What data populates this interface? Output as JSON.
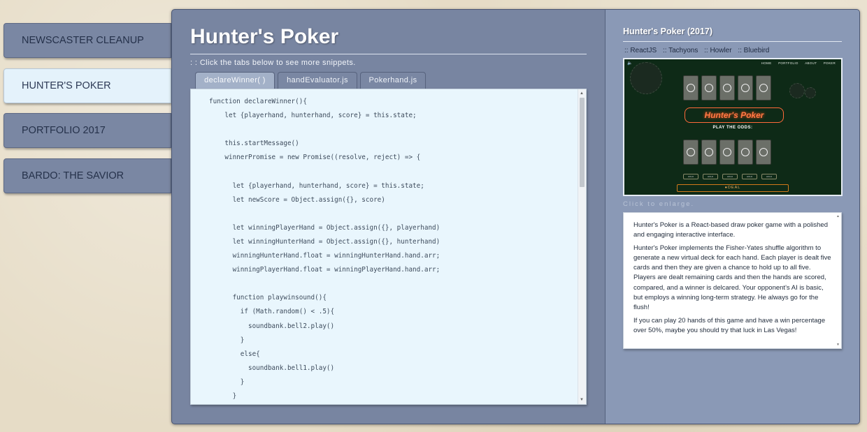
{
  "nav": {
    "items": [
      {
        "label": "NEWSCASTER CLEANUP",
        "active": false
      },
      {
        "label": "HUNTER'S POKER",
        "active": true
      },
      {
        "label": "PORTFOLIO 2017",
        "active": false
      },
      {
        "label": "BARDO: THE SAVIOR",
        "active": false
      }
    ]
  },
  "main": {
    "title": "Hunter's Poker",
    "hint": ": : Click the tabs below to see more snippets.",
    "tabs": [
      {
        "label": "declareWinner( )",
        "active": true
      },
      {
        "label": "handEvaluator.js",
        "active": false
      },
      {
        "label": "Pokerhand.js",
        "active": false
      }
    ],
    "code_lines": [
      "function declareWinner(){",
      "    let {playerhand, hunterhand, score} = this.state;",
      "",
      "    this.startMessage()",
      "    winnerPromise = new Promise((resolve, reject) => {",
      "",
      "      let {playerhand, hunterhand, score} = this.state;",
      "      let newScore = Object.assign({}, score)",
      "",
      "      let winningPlayerHand = Object.assign({}, playerhand)",
      "      let winningHunterHand = Object.assign({}, hunterhand)",
      "      winningHunterHand.float = winningHunterHand.hand.arr;",
      "      winningPlayerHand.float = winningPlayerHand.hand.arr;",
      "",
      "      function playwinsound(){",
      "        if (Math.random() < .5){",
      "          soundbank.bell2.play()",
      "        }",
      "        else{",
      "          soundbank.bell1.play()",
      "        }",
      "      }"
    ]
  },
  "project": {
    "title": "Hunter's Poker (2017)",
    "techs": [
      ":: ReactJS",
      ":: Tachyons",
      ":: Howler",
      ":: Bluebird"
    ],
    "preview": {
      "nav": [
        "HOME",
        "PORTFOLIO",
        "ABOUT",
        "POKER"
      ],
      "logo": "Hunter's Poker",
      "odds": "PLAY THE ODDS:",
      "hold": "HOLD",
      "deal": "●DEAL"
    },
    "enlarge": "Click to enlarge.",
    "description": [
      "Hunter's Poker is a React-based draw poker game with a polished and engaging interactive interface.",
      "Hunter's Poker implements the Fisher-Yates shuffle algorithm to generate a new virtual deck for each hand. Each player is dealt five cards and then they are given a chance to hold up to all five. Players are dealt remaining cards and then the hands are scored, compared, and a winner is delcared. Your opponent's AI is basic, but employs a winning long-term strategy. He always go for the flush!",
      "If you can play 20 hands of this game and have a win percentage over 50%, maybe you should try that luck in Las Vegas!"
    ]
  },
  "colors": {
    "panel": "#7885a1",
    "nav_active": "#e4f2fb",
    "code_bg": "#e9f6fd"
  }
}
